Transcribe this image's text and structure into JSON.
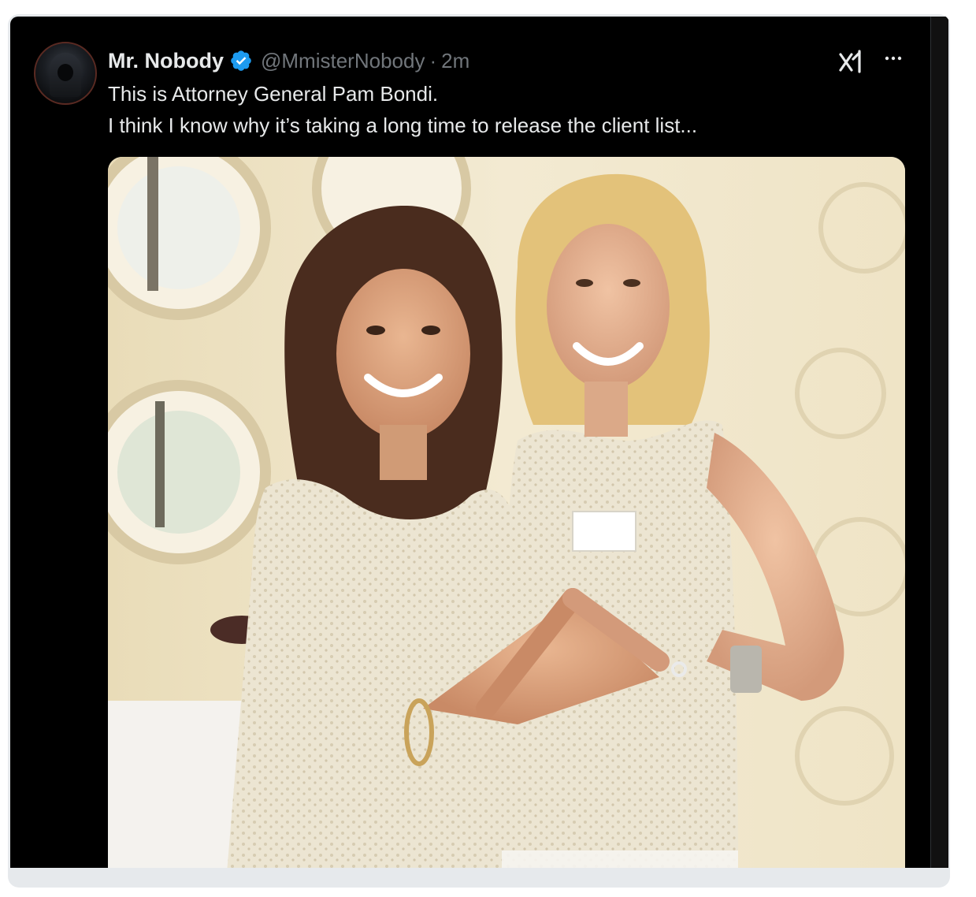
{
  "tweet": {
    "display_name": "Mr. Nobody",
    "handle": "@MmisterNobody",
    "separator": "·",
    "timestamp": "2m",
    "text_lines": [
      "This is Attorney General Pam Bondi.",
      "I think I know why it’s taking a long time to release the client list..."
    ]
  },
  "icons": {
    "verified": "verified-badge-icon",
    "grok": "grok-icon",
    "more": "more-options-icon"
  },
  "colors": {
    "card_background": "#000000",
    "primary_text": "#e7e9ea",
    "secondary_text": "#71767b",
    "verified_blue": "#1d9bf0",
    "frame": "#e6e9ec"
  }
}
